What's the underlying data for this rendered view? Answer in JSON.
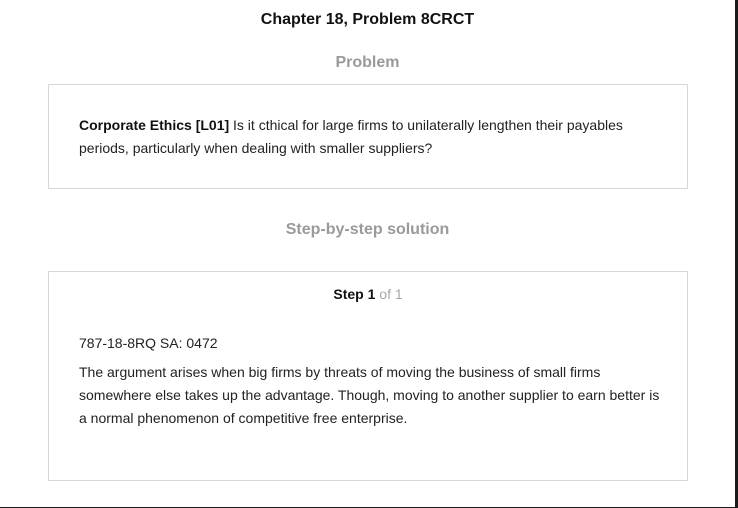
{
  "header": {
    "chapter_title": "Chapter 18, Problem 8CRCT"
  },
  "problem": {
    "heading": "Problem",
    "title_bold": "Corporate Ethics [L01]",
    "text": " Is it cthical for large firms to unilaterally lengthen their payables periods, particularly when dealing with smaller suppliers?"
  },
  "solution": {
    "heading": "Step-by-step solution",
    "step_label": "Step",
    "step_number": "1",
    "step_of": " of 1",
    "step_id": "787-18-8RQ SA: 0472",
    "step_text": "The argument arises when big firms by threats of moving the business of small firms somewhere else takes up the advantage. Though, moving to another supplier to earn better is a normal phenomenon of competitive free enterprise."
  }
}
